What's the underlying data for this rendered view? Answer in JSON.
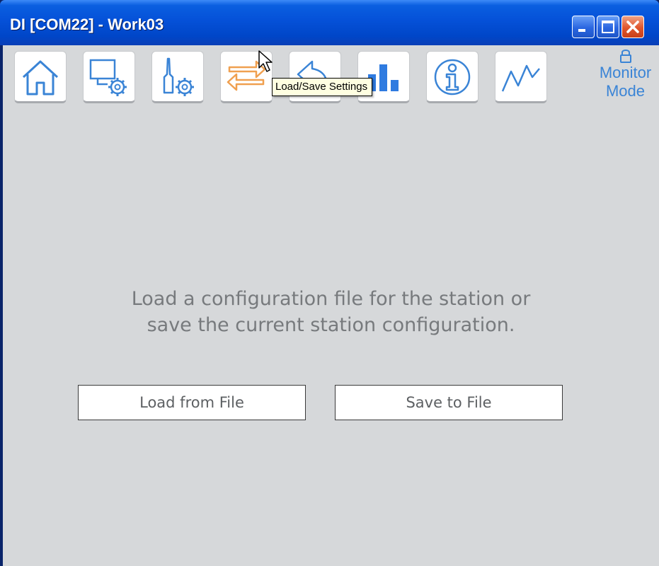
{
  "window": {
    "title": "DI [COM22] - Work03",
    "controls": [
      "minimize-icon",
      "maximize-icon",
      "close-icon"
    ]
  },
  "toolbar": {
    "items": [
      {
        "name": "home",
        "icon": "home-icon",
        "color": "#3a84d6"
      },
      {
        "name": "station-settings",
        "icon": "monitor-gear-icon",
        "color": "#3a84d6"
      },
      {
        "name": "tool-settings",
        "icon": "tool-gear-icon",
        "color": "#3a84d6"
      },
      {
        "name": "load-save-settings",
        "icon": "swap-arrows-icon",
        "color": "#f0a050",
        "active": true
      },
      {
        "name": "undo",
        "icon": "undo-icon",
        "color": "#3a84d6"
      },
      {
        "name": "statistics",
        "icon": "bar-chart-icon",
        "color": "#2f7be0"
      },
      {
        "name": "info",
        "icon": "info-icon",
        "color": "#3a84d6"
      },
      {
        "name": "graph",
        "icon": "line-graph-icon",
        "color": "#3a84d6"
      }
    ],
    "monitor_mode": {
      "line1": "Monitor",
      "line2": "Mode",
      "icon": "lock-icon"
    }
  },
  "tooltip": {
    "text": "Load/Save Settings"
  },
  "main": {
    "message_line1": "Load a configuration file for the station or",
    "message_line2": "save the current station configuration.",
    "load_button": "Load from File",
    "save_button": "Save to File"
  },
  "colors": {
    "accent": "#3a84d6",
    "active": "#f0a050",
    "background": "#d6d8da",
    "titlebar": "#0551d8"
  }
}
